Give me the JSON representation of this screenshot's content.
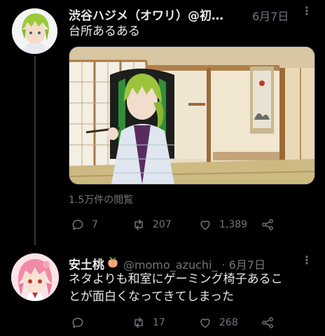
{
  "tweet1": {
    "author": "渋谷ハジメ（オワリ）@初…",
    "date": "6月7日",
    "text": "台所あるある",
    "views": "1.5万件の閲覧",
    "replies": "7",
    "retweets": "207",
    "likes": "1,389"
  },
  "tweet2": {
    "author": "安土桃",
    "handle": "@momo_azuchi_",
    "date": "· 6月7日",
    "text_line1": "ネタよりも和室にゲーミング椅子あるこ",
    "text_line2": "とが面白くなってきてしまった",
    "replies": "",
    "retweets": "17",
    "likes": "268"
  },
  "colors": {
    "background": "#000000",
    "text": "#e7e9ea",
    "muted": "#71767b"
  }
}
